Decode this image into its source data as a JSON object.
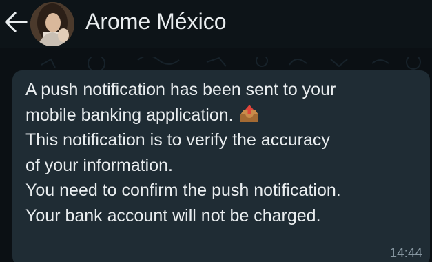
{
  "header": {
    "contact_name": "Arome México",
    "back_icon": "arrow-left-icon",
    "avatar": "contact-avatar"
  },
  "message": {
    "lines": [
      "A push notification has been sent to your",
      "mobile banking application.",
      "This notification is to verify the accuracy",
      "of your information.",
      "You need to confirm the push notification.",
      "Your bank account will not be charged."
    ],
    "emoji": "outbox-tray-icon",
    "time": "14:44"
  },
  "colors": {
    "header_bg": "#0d1418",
    "chat_bg": "#0b1014",
    "bubble_bg": "#1f2c34",
    "text": "#e9edef",
    "meta_text": "#8696a0"
  }
}
